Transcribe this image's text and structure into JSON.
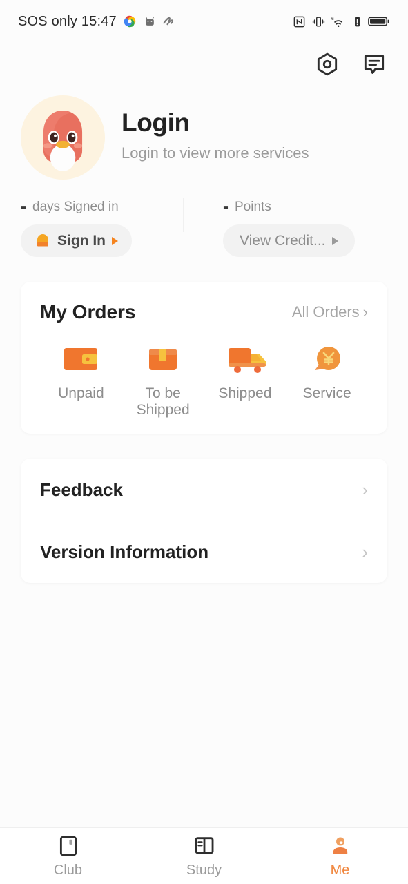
{
  "statusbar": {
    "carrier_time": "SOS only 15:47",
    "left_icons": [
      "photos-icon",
      "android-icon",
      "gesture-icon"
    ],
    "right_icons": [
      "nfc-icon",
      "vibrate-icon",
      "wifi6-icon",
      "alert-icon",
      "battery-icon"
    ]
  },
  "header": {
    "settings_icon": "hexagon-gear-icon",
    "message_icon": "chat-bubble-icon"
  },
  "profile": {
    "avatar_icon": "bird-mascot-avatar",
    "title": "Login",
    "subtitle": "Login to view more services"
  },
  "stats": {
    "signed_in": {
      "value": "-",
      "label": "days Signed in",
      "button_label": "Sign In",
      "button_icon": "gift-icon"
    },
    "points": {
      "value": "-",
      "label": "Points",
      "button_label": "View Credit..."
    }
  },
  "orders": {
    "title": "My Orders",
    "all_label": "All Orders",
    "all_chevron": "chevron-right-icon",
    "items": [
      {
        "label": "Unpaid",
        "icon": "wallet-icon"
      },
      {
        "label": "To be Shipped",
        "icon": "box-icon"
      },
      {
        "label": "Shipped",
        "icon": "truck-icon"
      },
      {
        "label": "Service",
        "icon": "yen-chat-icon"
      }
    ]
  },
  "menu": {
    "items": [
      {
        "label": "Feedback",
        "chevron": "chevron-right-icon"
      },
      {
        "label": "Version Information",
        "chevron": "chevron-right-icon"
      }
    ]
  },
  "tabbar": {
    "items": [
      {
        "label": "Club",
        "icon": "book-icon",
        "active": false
      },
      {
        "label": "Study",
        "icon": "panels-icon",
        "active": false
      },
      {
        "label": "Me",
        "icon": "person-icon",
        "active": true
      }
    ]
  },
  "colors": {
    "accent": "#f0853c",
    "orange": "#f0762e",
    "yellow": "#f8c93f",
    "bg": "#fafafa",
    "card": "#ffffff",
    "text": "#222222",
    "muted": "#8d8d8d"
  }
}
